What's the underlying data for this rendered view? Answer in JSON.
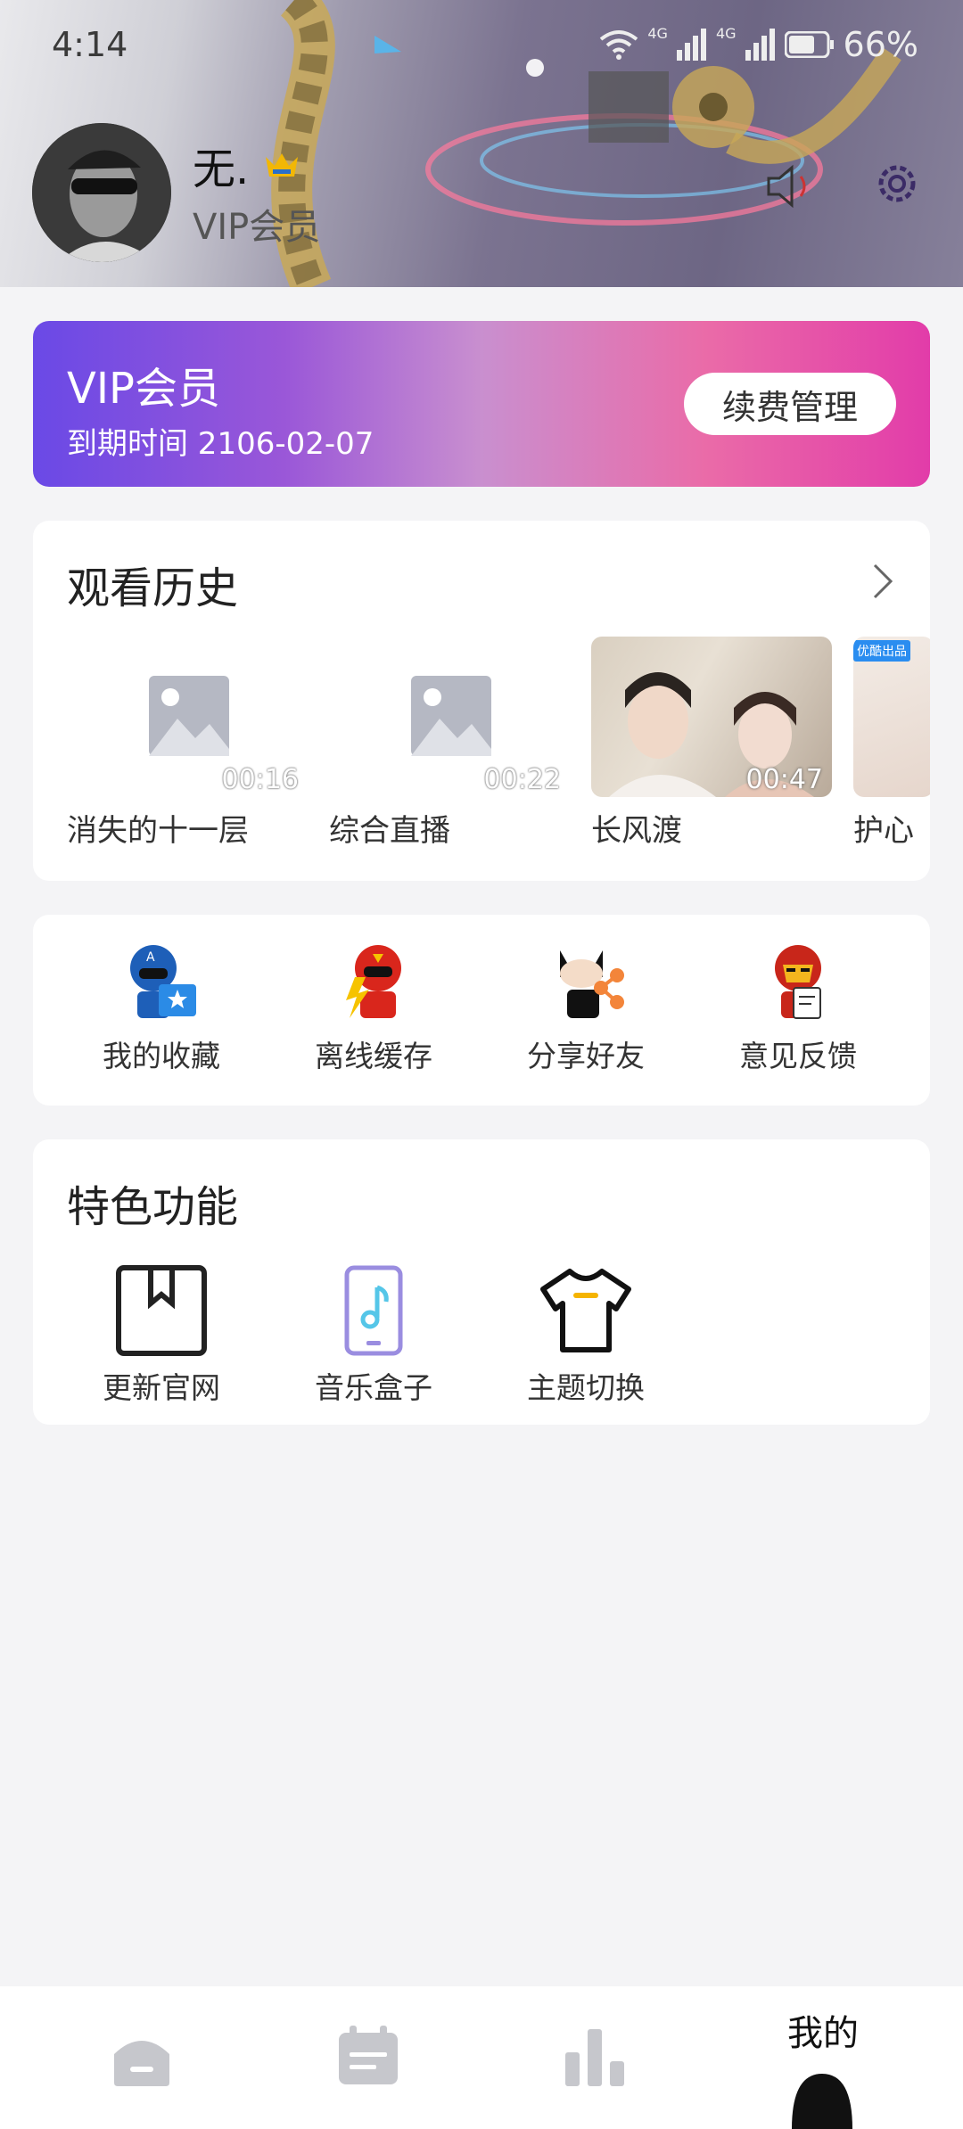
{
  "status_bar": {
    "time": "4:14",
    "battery": "66%",
    "net1": "4G",
    "net2": "4G"
  },
  "profile": {
    "name": "无.",
    "level": "VIP会员"
  },
  "vip_card": {
    "title": "VIP会员",
    "expiry": "到期时间 2106-02-07",
    "renew_label": "续费管理"
  },
  "history": {
    "title": "观看历史",
    "items": [
      {
        "title": "消失的十一层",
        "duration": "00:16"
      },
      {
        "title": "综合直播",
        "duration": "00:22"
      },
      {
        "title": "长风渡",
        "duration": "00:47"
      },
      {
        "title": "护心",
        "badge": "优酷出品"
      }
    ]
  },
  "quick_actions": [
    {
      "label": "我的收藏",
      "icon": "captain-america-icon"
    },
    {
      "label": "离线缓存",
      "icon": "flash-hero-icon"
    },
    {
      "label": "分享好友",
      "icon": "share-hero-icon"
    },
    {
      "label": "意见反馈",
      "icon": "iron-man-icon"
    }
  ],
  "features": {
    "title": "特色功能",
    "items": [
      {
        "label": "更新官网",
        "icon": "bookmark-icon"
      },
      {
        "label": "音乐盒子",
        "icon": "phone-music-icon"
      },
      {
        "label": "主题切换",
        "icon": "tshirt-icon"
      }
    ]
  },
  "bottom_nav": {
    "items": [
      {
        "label": "",
        "icon": "home-icon"
      },
      {
        "label": "",
        "icon": "calendar-icon"
      },
      {
        "label": "",
        "icon": "chart-icon"
      },
      {
        "label": "我的",
        "icon": "profile-icon"
      }
    ]
  },
  "colors": {
    "vip_gradient_start": "#6a49e6",
    "vip_gradient_end": "#e23ca9",
    "background": "#f4f4f6"
  }
}
